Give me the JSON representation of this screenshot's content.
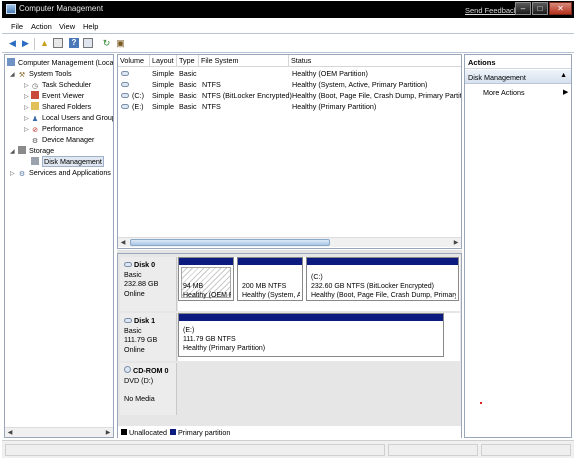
{
  "window": {
    "title": "Computer Management",
    "feedback_link": "Send Feedback",
    "min_glyph": "–",
    "max_glyph": "□",
    "close_glyph": "✕"
  },
  "menu": {
    "file": "File",
    "action": "Action",
    "view": "View",
    "help": "Help"
  },
  "tree": {
    "root": "Computer Management (Local",
    "system_tools": "System Tools",
    "task_scheduler": "Task Scheduler",
    "event_viewer": "Event Viewer",
    "shared_folders": "Shared Folders",
    "local_users": "Local Users and Groups",
    "performance": "Performance",
    "device_manager": "Device Manager",
    "storage": "Storage",
    "disk_management": "Disk Management",
    "services": "Services and Applications"
  },
  "volumes": {
    "columns": [
      "Volume",
      "Layout",
      "Type",
      "File System",
      "Status"
    ],
    "rows": [
      {
        "volume": "",
        "layout": "Simple",
        "type": "Basic",
        "fs": "",
        "status": "Healthy (OEM Partition)"
      },
      {
        "volume": "",
        "layout": "Simple",
        "type": "Basic",
        "fs": "NTFS",
        "status": "Healthy (System, Active, Primary Partition)"
      },
      {
        "volume": "(C:)",
        "layout": "Simple",
        "type": "Basic",
        "fs": "NTFS (BitLocker Encrypted)",
        "status": "Healthy (Boot, Page File, Crash Dump, Primary Partitio"
      },
      {
        "volume": "(E:)",
        "layout": "Simple",
        "type": "Basic",
        "fs": "NTFS",
        "status": "Healthy (Primary Partition)"
      }
    ]
  },
  "disks": {
    "disk0": {
      "name": "Disk 0",
      "type": "Basic",
      "size": "232.88 GB",
      "status": "Online",
      "p1": {
        "size": "94 MB",
        "status": "Healthy (OEM P"
      },
      "p2": {
        "size": "200 MB NTFS",
        "status": "Healthy (System, A"
      },
      "p3": {
        "label": "(C:)",
        "size": "232.60 GB NTFS (BitLocker Encrypted)",
        "status": "Healthy (Boot, Page File, Crash Dump, Primary Pá"
      }
    },
    "disk1": {
      "name": "Disk 1",
      "type": "Basic",
      "size": "111.79 GB",
      "status": "Online",
      "p1": {
        "label": "(E:)",
        "size": "111.79 GB NTFS",
        "status": "Healthy (Primary Partition)"
      }
    },
    "cdrom": {
      "name": "CD-ROM 0",
      "type": "DVD (D:)",
      "status": "No Media"
    }
  },
  "legend": {
    "unallocated": "Unallocated",
    "primary": "Primary partition",
    "unallocated_color": "#000000",
    "primary_color": "#0b1b7f"
  },
  "actions": {
    "header": "Actions",
    "section": "Disk Management",
    "more": "More Actions"
  }
}
